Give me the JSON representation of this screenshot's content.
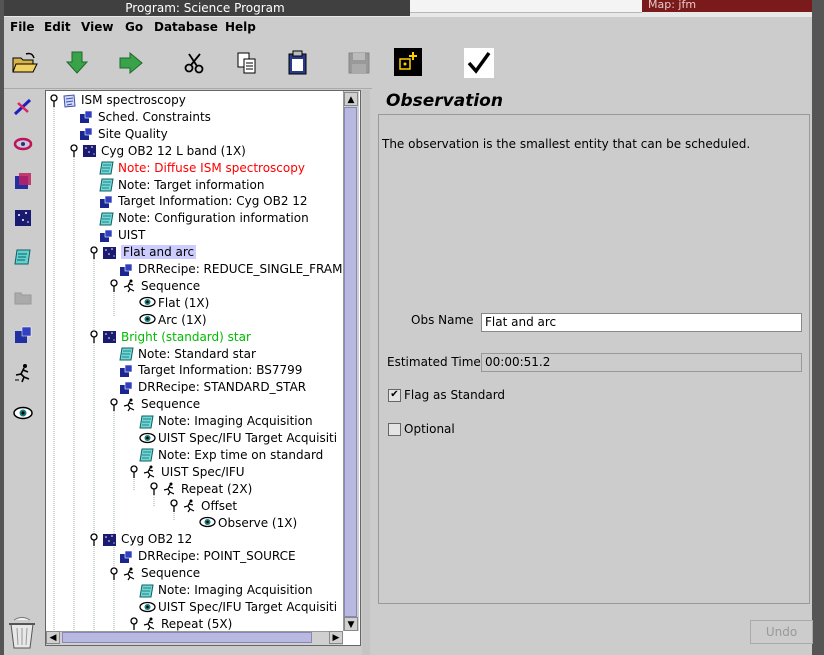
{
  "window": {
    "title": "Program: Science Program",
    "right_fragment": "Map: jfm"
  },
  "menubar": {
    "items": [
      "File",
      "Edit",
      "View",
      "Go",
      "Database",
      "Help"
    ]
  },
  "toolbar": {
    "icons": [
      "open-folder-icon",
      "green-down-arrow-icon",
      "green-right-arrow-icon",
      "scissors-icon",
      "copy-icon",
      "paste-icon",
      "save-icon",
      "add-component-icon",
      "validate-checkmark-icon"
    ]
  },
  "palette": {
    "icons": [
      "telescope-icon",
      "site-quality-icon",
      "survey-container-icon",
      "observation-icon",
      "note-icon",
      "folder-icon",
      "component-icon",
      "iterator-icon",
      "observe-eye-icon"
    ]
  },
  "tree": {
    "rows": [
      {
        "label": "ISM spectroscopy",
        "icon": "program",
        "depth": 0,
        "knob": true,
        "style": "normal"
      },
      {
        "label": "Sched. Constraints",
        "icon": "component",
        "depth": 1,
        "knob": false,
        "style": "normal"
      },
      {
        "label": "Site Quality",
        "icon": "component",
        "depth": 1,
        "knob": false,
        "style": "normal"
      },
      {
        "label": "Cyg OB2 12 L band (1X)",
        "icon": "observation",
        "depth": 1,
        "knob": true,
        "style": "normal"
      },
      {
        "label": "Note: Diffuse ISM spectroscopy",
        "icon": "note",
        "depth": 2,
        "knob": false,
        "style": "red"
      },
      {
        "label": "Note: Target information",
        "icon": "note",
        "depth": 2,
        "knob": false,
        "style": "normal"
      },
      {
        "label": "Target Information: Cyg OB2 12",
        "icon": "component",
        "depth": 2,
        "knob": false,
        "style": "normal"
      },
      {
        "label": "Note: Configuration information",
        "icon": "note",
        "depth": 2,
        "knob": false,
        "style": "normal"
      },
      {
        "label": "UIST",
        "icon": "component",
        "depth": 2,
        "knob": false,
        "style": "normal"
      },
      {
        "label": "Flat and arc",
        "icon": "observation",
        "depth": 2,
        "knob": true,
        "style": "selected"
      },
      {
        "label": "DRRecipe: REDUCE_SINGLE_FRAM",
        "icon": "component",
        "depth": 3,
        "knob": false,
        "style": "normal"
      },
      {
        "label": "Sequence",
        "icon": "iterator",
        "depth": 3,
        "knob": true,
        "style": "normal"
      },
      {
        "label": "Flat (1X)",
        "icon": "eye",
        "depth": 4,
        "knob": false,
        "style": "normal"
      },
      {
        "label": "Arc (1X)",
        "icon": "eye",
        "depth": 4,
        "knob": false,
        "style": "normal"
      },
      {
        "label": "Bright (standard) star",
        "icon": "observation",
        "depth": 2,
        "knob": true,
        "style": "green"
      },
      {
        "label": "Note: Standard star",
        "icon": "note",
        "depth": 3,
        "knob": false,
        "style": "normal"
      },
      {
        "label": "Target Information: BS7799",
        "icon": "component",
        "depth": 3,
        "knob": false,
        "style": "normal"
      },
      {
        "label": "DRRecipe: STANDARD_STAR",
        "icon": "component",
        "depth": 3,
        "knob": false,
        "style": "normal"
      },
      {
        "label": "Sequence",
        "icon": "iterator",
        "depth": 3,
        "knob": true,
        "style": "normal"
      },
      {
        "label": "Note: Imaging Acquisition",
        "icon": "note",
        "depth": 4,
        "knob": false,
        "style": "normal"
      },
      {
        "label": "UIST Spec/IFU Target Acquisiti",
        "icon": "eye",
        "depth": 4,
        "knob": false,
        "style": "normal"
      },
      {
        "label": "Note: Exp time on standard",
        "icon": "note",
        "depth": 4,
        "knob": false,
        "style": "normal"
      },
      {
        "label": "UIST Spec/IFU",
        "icon": "iterator",
        "depth": 4,
        "knob": true,
        "style": "normal"
      },
      {
        "label": "Repeat (2X)",
        "icon": "iterator",
        "depth": 5,
        "knob": true,
        "style": "normal"
      },
      {
        "label": "Offset",
        "icon": "iterator",
        "depth": 6,
        "knob": true,
        "style": "normal"
      },
      {
        "label": "Observe (1X)",
        "icon": "eye",
        "depth": 7,
        "knob": false,
        "style": "normal"
      },
      {
        "label": "Cyg OB2 12",
        "icon": "observation",
        "depth": 2,
        "knob": true,
        "style": "normal"
      },
      {
        "label": "DRRecipe: POINT_SOURCE",
        "icon": "component",
        "depth": 3,
        "knob": false,
        "style": "normal"
      },
      {
        "label": "Sequence",
        "icon": "iterator",
        "depth": 3,
        "knob": true,
        "style": "normal"
      },
      {
        "label": "Note: Imaging Acquisition",
        "icon": "note",
        "depth": 4,
        "knob": false,
        "style": "normal"
      },
      {
        "label": "UIST Spec/IFU Target Acquisiti",
        "icon": "eye",
        "depth": 4,
        "knob": false,
        "style": "normal"
      },
      {
        "label": "Repeat (5X)",
        "icon": "iterator",
        "depth": 4,
        "knob": true,
        "style": "normal"
      }
    ]
  },
  "panel": {
    "title": "Observation",
    "description": "The observation is the smallest entity that can be scheduled.",
    "obs_name_label": "Obs Name",
    "obs_name_value": "Flat and arc",
    "est_time_label": "Estimated Time",
    "est_time_value": "00:00:51.2",
    "flag_standard_label": "Flag as Standard",
    "flag_standard_checked": true,
    "optional_label": "Optional",
    "optional_checked": false,
    "undo_label": "Undo"
  },
  "colors": {
    "red_note": "#ff0000",
    "green_obs": "#00bb00",
    "selection": "#ccccff",
    "scroll_thumb": "#b8b8e0"
  }
}
